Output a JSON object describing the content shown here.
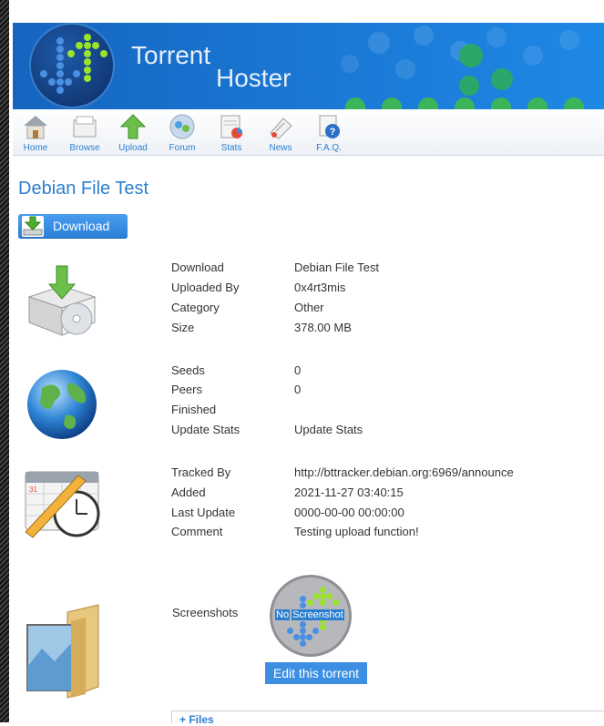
{
  "brand": {
    "line1": "Torrent",
    "line2": "Hoster"
  },
  "nav": [
    {
      "label": "Home",
      "icon": "home-icon"
    },
    {
      "label": "Browse",
      "icon": "browse-icon"
    },
    {
      "label": "Upload",
      "icon": "upload-icon"
    },
    {
      "label": "Forum",
      "icon": "forum-icon"
    },
    {
      "label": "Stats",
      "icon": "stats-icon"
    },
    {
      "label": "News",
      "icon": "news-icon"
    },
    {
      "label": "F.A.Q.",
      "icon": "faq-icon"
    }
  ],
  "torrent": {
    "title": "Debian File Test",
    "download_button": "Download"
  },
  "details": {
    "download": {
      "label": "Download",
      "value": "Debian File Test"
    },
    "uploaded_by": {
      "label": "Uploaded By",
      "value": "0x4rt3mis"
    },
    "category": {
      "label": "Category",
      "value": "Other"
    },
    "size": {
      "label": "Size",
      "value": "378.00 MB"
    }
  },
  "stats": {
    "seeds": {
      "label": "Seeds",
      "value": "0"
    },
    "peers": {
      "label": "Peers",
      "value": "0"
    },
    "finished": {
      "label": "Finished",
      "value": ""
    },
    "update_stats": {
      "label": "Update Stats",
      "value": "Update Stats"
    }
  },
  "tracker": {
    "tracked_by": {
      "label": "Tracked By",
      "value": "http://bttracker.debian.org:6969/announce"
    },
    "added": {
      "label": "Added",
      "value": "2021-11-27 03:40:15"
    },
    "last_update": {
      "label": "Last Update",
      "value": "0000-00-00 00:00:00"
    },
    "comment": {
      "label": "Comment",
      "value": "Testing upload function!"
    }
  },
  "screenshots": {
    "label": "Screenshots",
    "placeholder_no": "No",
    "placeholder_screenshot": "Screenshot",
    "edit_button": "Edit this torrent"
  },
  "files": {
    "label": "+ Files"
  },
  "colors": {
    "accent": "#2b7fd0",
    "banner": "#1976d2",
    "arrow_green": "#9be22d",
    "arrow_blue": "#4a90e2"
  }
}
